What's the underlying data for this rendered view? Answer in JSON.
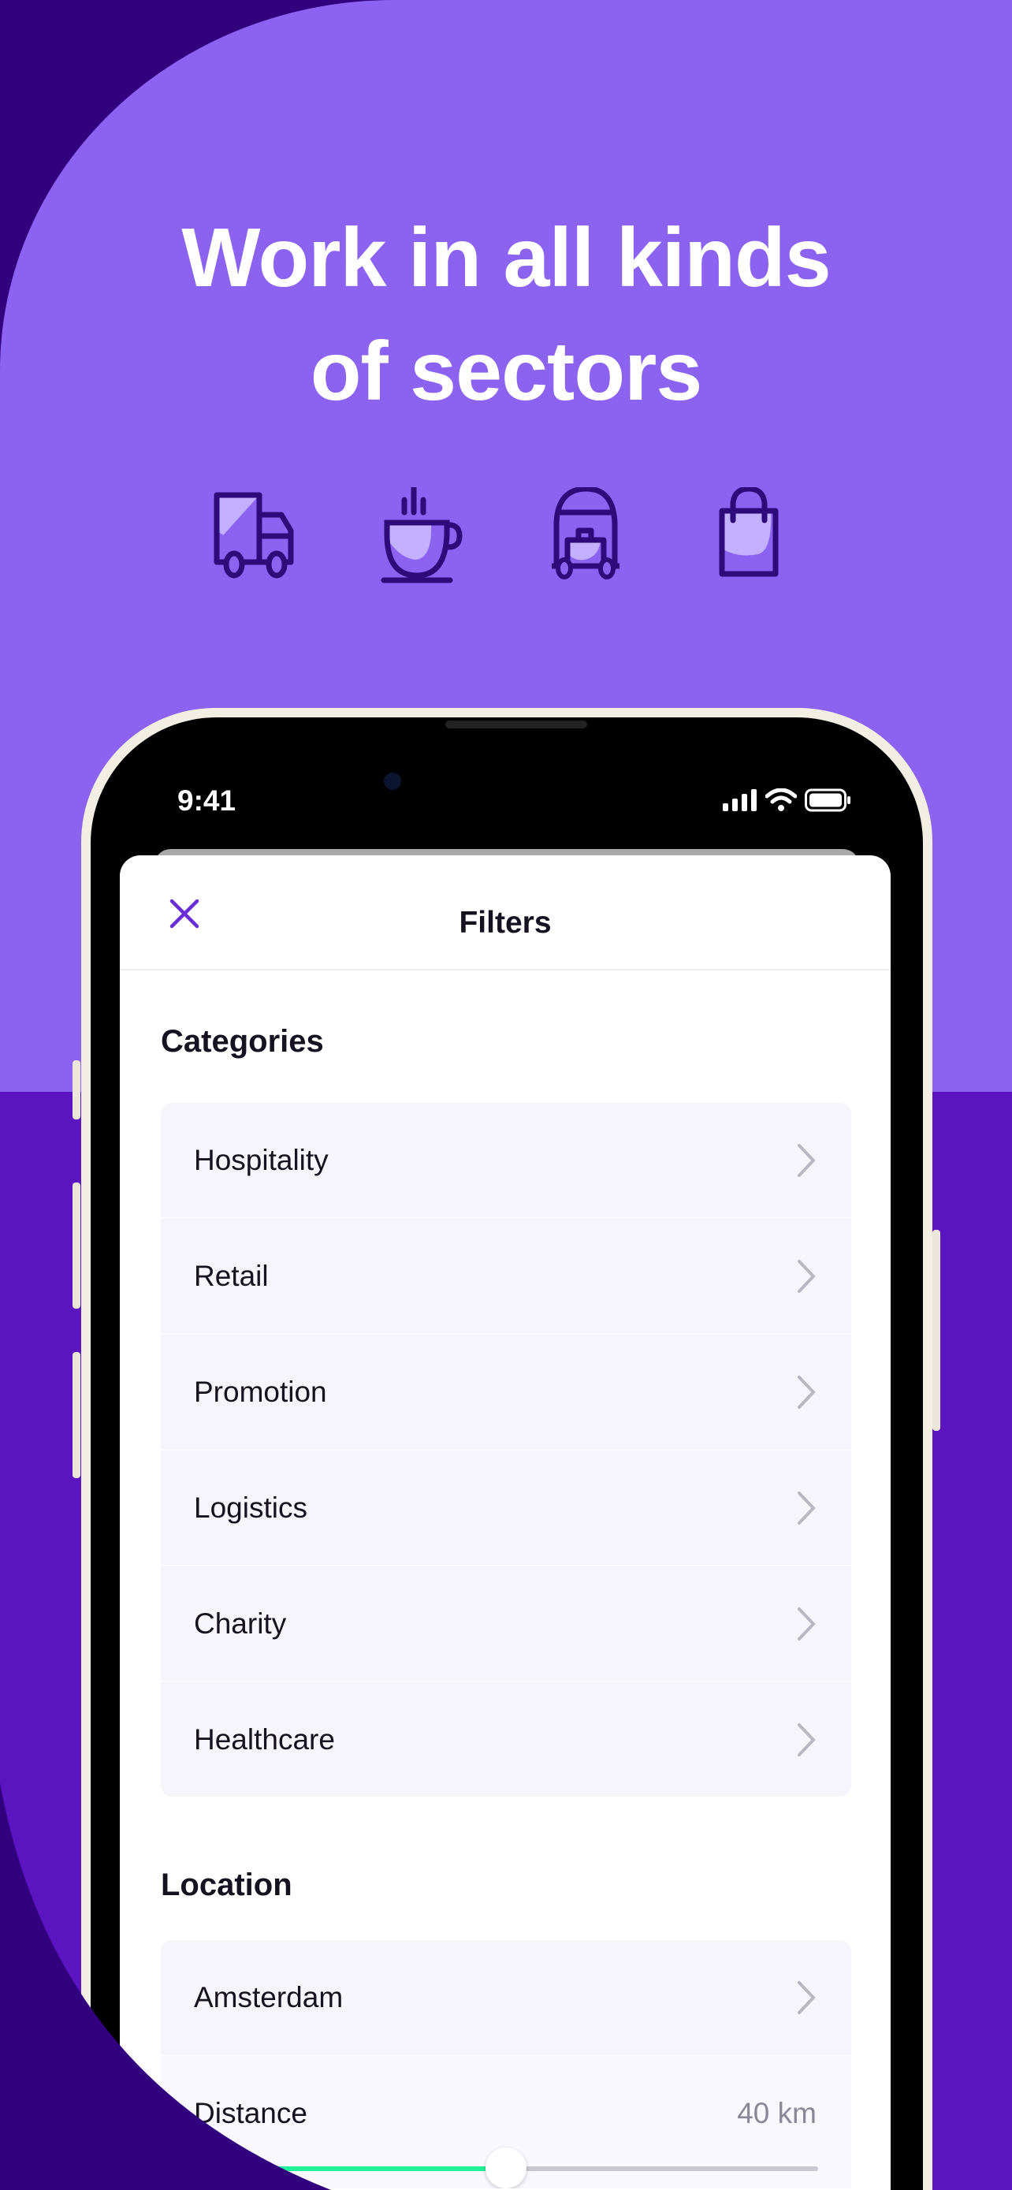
{
  "headline": {
    "line1": "Work in all kinds",
    "line2": "of sectors"
  },
  "sector_icons": [
    "truck-icon",
    "coffee-cup-icon",
    "hotel-luggage-cart-icon",
    "shopping-bag-icon"
  ],
  "colors": {
    "bg_light": "#8c63f1",
    "bg_deep": "#5a14c0",
    "bg_dark": "#32007f",
    "icon_stroke": "#2e0a7a",
    "icon_fill": "#c3b0ff",
    "accent": "#6a2ed6",
    "slider_fill": "#22f09a"
  },
  "status_bar": {
    "time": "9:41"
  },
  "filters": {
    "title": "Filters",
    "categories_heading": "Categories",
    "categories": [
      {
        "label": "Hospitality"
      },
      {
        "label": "Retail"
      },
      {
        "label": "Promotion"
      },
      {
        "label": "Logistics"
      },
      {
        "label": "Charity"
      },
      {
        "label": "Healthcare"
      }
    ],
    "location_heading": "Location",
    "location": {
      "city": "Amsterdam",
      "distance_label": "Distance",
      "distance_value": "40 km",
      "slider_fraction": 0.5
    }
  }
}
